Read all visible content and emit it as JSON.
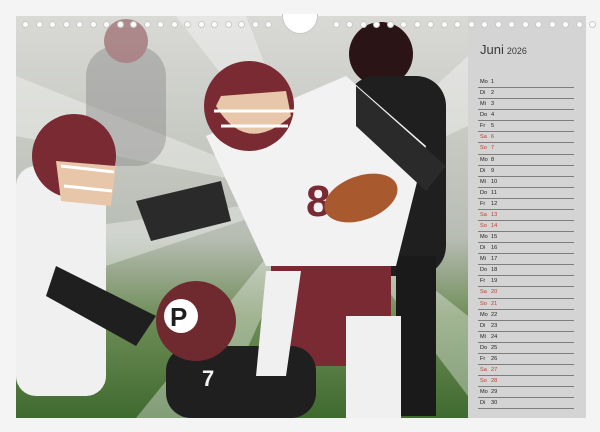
{
  "calendar": {
    "month": "Juni",
    "year": "2026",
    "days": [
      {
        "n": "Mo",
        "d": "1",
        "we": false
      },
      {
        "n": "Di",
        "d": "2",
        "we": false
      },
      {
        "n": "Mi",
        "d": "3",
        "we": false
      },
      {
        "n": "Do",
        "d": "4",
        "we": false
      },
      {
        "n": "Fr",
        "d": "5",
        "we": false
      },
      {
        "n": "Sa",
        "d": "6",
        "we": true
      },
      {
        "n": "So",
        "d": "7",
        "we": true
      },
      {
        "n": "Mo",
        "d": "8",
        "we": false
      },
      {
        "n": "Di",
        "d": "9",
        "we": false
      },
      {
        "n": "Mi",
        "d": "10",
        "we": false
      },
      {
        "n": "Do",
        "d": "11",
        "we": false
      },
      {
        "n": "Fr",
        "d": "12",
        "we": false
      },
      {
        "n": "Sa",
        "d": "13",
        "we": true
      },
      {
        "n": "So",
        "d": "14",
        "we": true
      },
      {
        "n": "Mo",
        "d": "15",
        "we": false
      },
      {
        "n": "Di",
        "d": "16",
        "we": false
      },
      {
        "n": "Mi",
        "d": "17",
        "we": false
      },
      {
        "n": "Do",
        "d": "18",
        "we": false
      },
      {
        "n": "Fr",
        "d": "19",
        "we": false
      },
      {
        "n": "Sa",
        "d": "20",
        "we": true
      },
      {
        "n": "So",
        "d": "21",
        "we": true
      },
      {
        "n": "Mo",
        "d": "22",
        "we": false
      },
      {
        "n": "Di",
        "d": "23",
        "we": false
      },
      {
        "n": "Mi",
        "d": "24",
        "we": false
      },
      {
        "n": "Do",
        "d": "25",
        "we": false
      },
      {
        "n": "Fr",
        "d": "26",
        "we": false
      },
      {
        "n": "Sa",
        "d": "27",
        "we": true
      },
      {
        "n": "So",
        "d": "28",
        "we": true
      },
      {
        "n": "Mo",
        "d": "29",
        "we": false
      },
      {
        "n": "Di",
        "d": "30",
        "we": false
      }
    ]
  },
  "photo": {
    "jersey_number_main": "8",
    "jersey_number_left": "7",
    "helmet_letter": "P",
    "colors": {
      "maroon": "#7a2a33",
      "white": "#f2f2f2",
      "black": "#1c1c1c",
      "field": "#4f7a3a",
      "weekend": "#c0392b"
    }
  }
}
